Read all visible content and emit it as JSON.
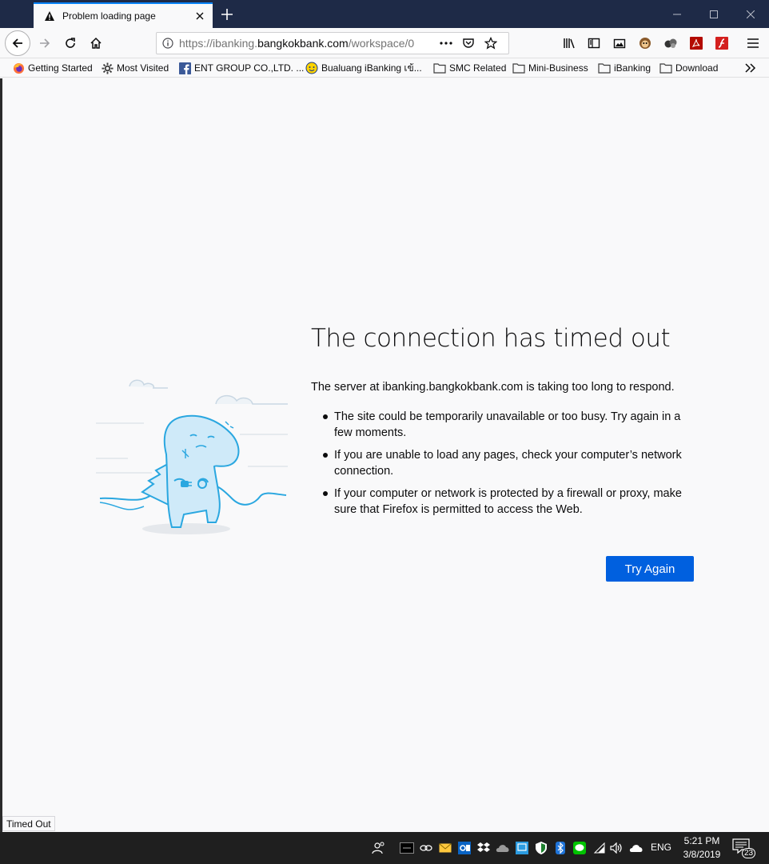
{
  "tab": {
    "title": "Problem loading page"
  },
  "urlbar": {
    "prefix": "https://ibanking.",
    "host": "bangkokbank.com",
    "path": "/workspace/0"
  },
  "bookmarks": [
    {
      "label": "Getting Started",
      "icon": "firefox-icon"
    },
    {
      "label": "Most Visited",
      "icon": "gear-icon"
    },
    {
      "label": "ENT GROUP CO.,LTD. ...",
      "icon": "facebook-icon"
    },
    {
      "label": "Bualuang iBanking เข้...",
      "icon": "bualuang-icon"
    },
    {
      "label": "SMC Related",
      "icon": "folder-icon"
    },
    {
      "label": "Mini-Business",
      "icon": "folder-icon"
    },
    {
      "label": "iBanking",
      "icon": "folder-icon"
    },
    {
      "label": "Download",
      "icon": "folder-icon"
    }
  ],
  "error": {
    "title": "The connection has timed out",
    "description": "The server at ibanking.bangkokbank.com is taking too long to respond.",
    "items": [
      "The site could be temporarily unavailable or too busy. Try again in a few moments.",
      "If you are unable to load any pages, check your computer’s network connection.",
      "If your computer or network is protected by a firewall or proxy, make sure that Firefox is permitted to access the Web."
    ],
    "button": "Try Again"
  },
  "status": "Timed Out",
  "taskbar": {
    "language": "ENG",
    "time": "5:21 PM",
    "date": "3/8/2019",
    "notification_count": "23"
  },
  "colors": {
    "accent": "#0060df",
    "titlebar": "#1e2a47",
    "taskbar": "#1f1f1f"
  }
}
